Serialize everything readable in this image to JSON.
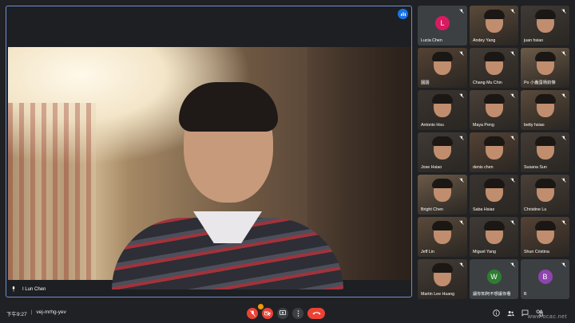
{
  "main_speaker": {
    "name": "I Lun Chen"
  },
  "participants": [
    {
      "name": "Lucia Chen",
      "avatar_letter": "L",
      "avatar_color": "#d81b60",
      "video": false
    },
    {
      "name": "Andey Yang",
      "video": true
    },
    {
      "name": "juan hsiao",
      "video": true
    },
    {
      "name": "園園",
      "video": true
    },
    {
      "name": "Chang Mu Chin",
      "video": true
    },
    {
      "name": "Po 小蠢蛋杨鈞傑",
      "video": true
    },
    {
      "name": "Antonio Hsu",
      "video": true
    },
    {
      "name": "Maya Peng",
      "video": true
    },
    {
      "name": "betty hsiao",
      "video": true
    },
    {
      "name": "Jose Hsiao",
      "video": true
    },
    {
      "name": "denis chen",
      "video": true
    },
    {
      "name": "Susana Sun",
      "video": true
    },
    {
      "name": "Bright Chen",
      "video": true
    },
    {
      "name": "Saba Hsiao",
      "video": true
    },
    {
      "name": "Christine Lu",
      "video": true
    },
    {
      "name": "Jeff Lin",
      "video": true
    },
    {
      "name": "Miguel Yang",
      "video": true
    },
    {
      "name": "Shun Cristina",
      "video": true
    },
    {
      "name": "Martin Lee Huang",
      "video": true
    },
    {
      "name": "讓你知阿不想讓你看",
      "avatar_letter": "W",
      "avatar_color": "#2e7d32",
      "video": false
    },
    {
      "name": "B",
      "avatar_letter": "B",
      "avatar_color": "#8e44ad",
      "video": false
    }
  ],
  "meeting": {
    "time": "下午9:27",
    "code": "vej-mrhg-yev"
  },
  "colors": {
    "leave": "#ea4335",
    "accent": "#1a73e8",
    "badge": "#f29900"
  },
  "watermark": "www.ocac.net"
}
